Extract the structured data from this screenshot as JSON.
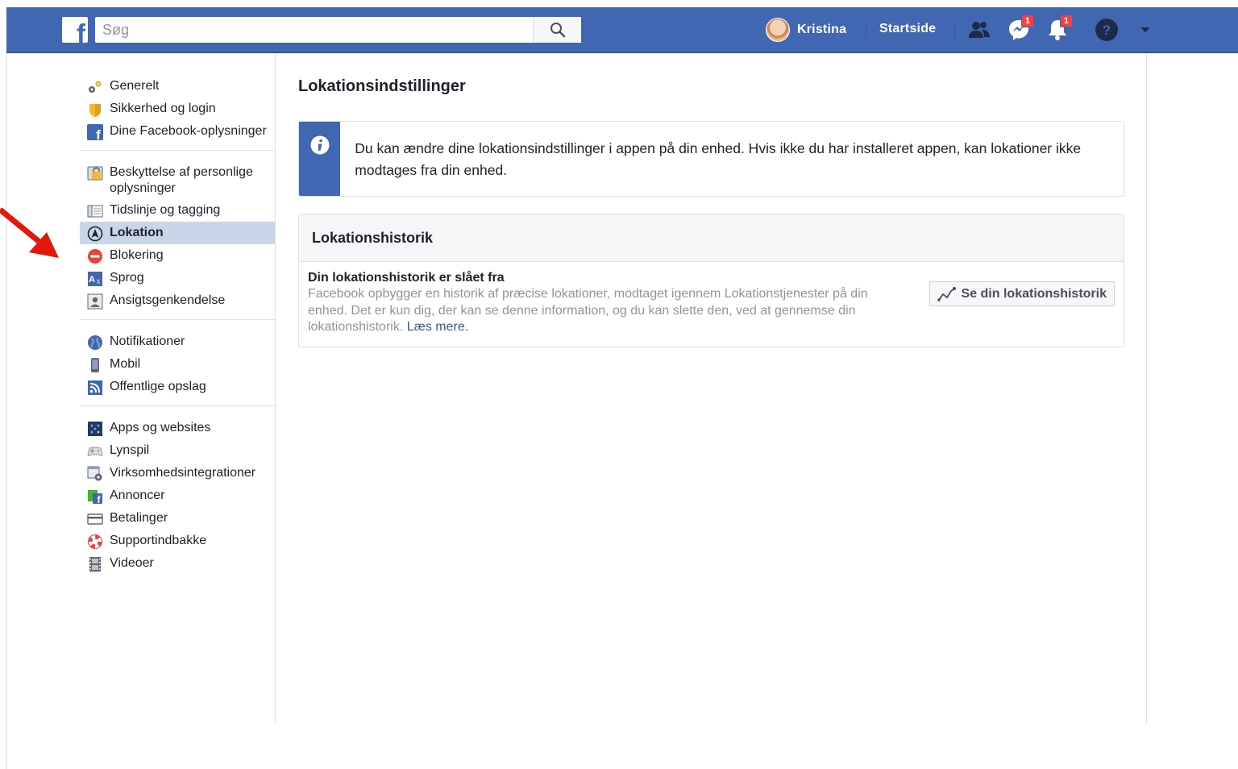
{
  "topbar": {
    "search_placeholder": "Søg",
    "user_name": "Kristina",
    "home_label": "Startside",
    "messages_badge": "1",
    "notifications_badge": "1"
  },
  "sidebar": {
    "groups": [
      {
        "items": [
          {
            "label": "Generelt",
            "icon": "gears-icon"
          },
          {
            "label": "Sikkerhed og login",
            "icon": "shield-icon"
          },
          {
            "label": "Dine Facebook-oplysninger",
            "icon": "facebook-icon"
          }
        ]
      },
      {
        "items": [
          {
            "label": "Beskyttelse af personlige oplysninger",
            "icon": "lock-icon"
          },
          {
            "label": "Tidslinje og tagging",
            "icon": "timeline-icon"
          },
          {
            "label": "Lokation",
            "icon": "location-icon",
            "active": true
          },
          {
            "label": "Blokering",
            "icon": "block-icon"
          },
          {
            "label": "Sprog",
            "icon": "language-icon"
          },
          {
            "label": "Ansigtsgenkendelse",
            "icon": "face-recognition-icon"
          }
        ]
      },
      {
        "items": [
          {
            "label": "Notifikationer",
            "icon": "globe-icon"
          },
          {
            "label": "Mobil",
            "icon": "mobile-icon"
          },
          {
            "label": "Offentlige opslag",
            "icon": "rss-icon"
          }
        ]
      },
      {
        "items": [
          {
            "label": "Apps og websites",
            "icon": "apps-icon"
          },
          {
            "label": "Lynspil",
            "icon": "gamepad-icon"
          },
          {
            "label": "Virksomhedsintegrationer",
            "icon": "business-integration-icon"
          },
          {
            "label": "Annoncer",
            "icon": "ads-icon"
          },
          {
            "label": "Betalinger",
            "icon": "credit-card-icon"
          },
          {
            "label": "Supportindbakke",
            "icon": "lifebuoy-icon"
          },
          {
            "label": "Videoer",
            "icon": "film-icon"
          }
        ]
      }
    ]
  },
  "main": {
    "title": "Lokationsindstillinger",
    "info_text": "Du kan ændre dine lokationsindstillinger i appen på din enhed. Hvis ikke du har installeret appen, kan lokationer ikke modtages fra din enhed.",
    "history": {
      "header": "Lokationshistorik",
      "status_title": "Din lokationshistorik er slået fra",
      "description": "Facebook opbygger en historik af præcise lokationer, modtaget igennem Lokationstjenester på din enhed. Det er kun dig, der kan se denne information, og du kan slette den, ved at gennemse din lokationshistorik.",
      "learn_more": "Læs mere.",
      "button_label": "Se din lokationshistorik"
    }
  },
  "colors": {
    "brand_blue": "#4267b2",
    "active_bg": "#c9d6ea",
    "link": "#365899",
    "annotation_arrow": "#e3170a"
  }
}
